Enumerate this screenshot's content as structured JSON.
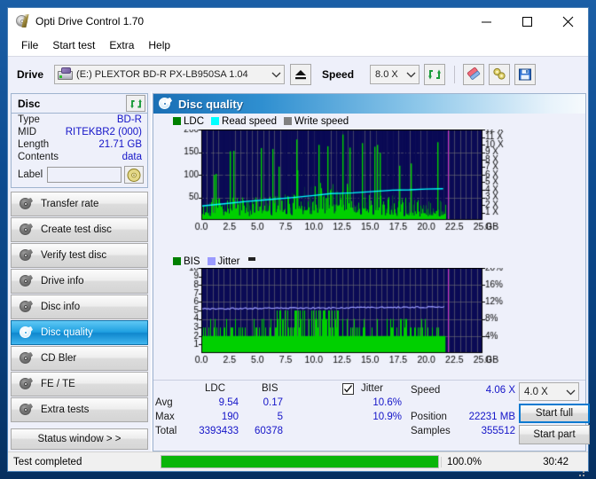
{
  "window": {
    "title": "Opti Drive Control 1.70",
    "icon": "disc-icon",
    "minimize": "minimize-icon",
    "maximize": "maximize-icon",
    "close": "close-icon"
  },
  "menu": {
    "items": [
      "File",
      "Start test",
      "Extra",
      "Help"
    ]
  },
  "toolbar": {
    "drive_label": "Drive",
    "drive_value": "(E:)  PLEXTOR BD-R  PX-LB950SA 1.04",
    "eject_icon": "eject-icon",
    "speed_label": "Speed",
    "speed_value": "8.0 X",
    "refresh_icon": "refresh-icon",
    "erase_icon": "eraser-icon",
    "tools_icon": "tools-icon",
    "save_icon": "save-floppy-icon"
  },
  "disc_panel": {
    "title": "Disc",
    "refresh_icon": "refresh-icon",
    "rows": [
      {
        "key": "Type",
        "value": "BD-R"
      },
      {
        "key": "MID",
        "value": "RITEKBR2 (000)"
      },
      {
        "key": "Length",
        "value": "21.71 GB"
      },
      {
        "key": "Contents",
        "value": "data"
      }
    ],
    "label_key": "Label",
    "label_value": "",
    "label_placeholder": "",
    "label_button_icon": "cd-icon"
  },
  "nav": {
    "items": [
      {
        "label": "Transfer rate",
        "active": false
      },
      {
        "label": "Create test disc",
        "active": false
      },
      {
        "label": "Verify test disc",
        "active": false
      },
      {
        "label": "Drive info",
        "active": false
      },
      {
        "label": "Disc info",
        "active": false
      },
      {
        "label": "Disc quality",
        "active": true
      },
      {
        "label": "CD Bler",
        "active": false
      },
      {
        "label": "FE / TE",
        "active": false
      },
      {
        "label": "Extra tests",
        "active": false
      }
    ],
    "status_window": "Status window > >"
  },
  "content": {
    "title": "Disc quality",
    "title_icon": "disc-quality-icon"
  },
  "chart_data": [
    {
      "type": "area",
      "title": "LDC / Read speed",
      "legend": [
        {
          "label": "LDC",
          "color": "#008000"
        },
        {
          "label": "Read speed",
          "color": "#00ffff"
        },
        {
          "label": "Write speed",
          "color": "#808080"
        }
      ],
      "legend_position": "top-left",
      "grid": true,
      "xlabel": "GB",
      "xlim": [
        0,
        25
      ],
      "xticks": [
        "0.0",
        "2.5",
        "5.0",
        "7.5",
        "10.0",
        "12.5",
        "15.0",
        "17.5",
        "20.0",
        "22.5",
        "25.0"
      ],
      "ylabel_left": "LDC",
      "ylim": [
        0,
        200
      ],
      "yticks_left": [
        "200",
        "150",
        "100",
        "50"
      ],
      "ylabel_right": "Speed",
      "ylim_right": [
        0,
        12
      ],
      "yticks_right": [
        "12 X",
        "11 X",
        "10 X",
        "9 X",
        "8 X",
        "7 X",
        "6 X",
        "5 X",
        "4 X",
        "3 X",
        "2 X",
        "1 X"
      ],
      "data_end_gb": 21.71,
      "cursor_gb": 21.9,
      "series": [
        {
          "name": "LDC",
          "color": "#00d000",
          "type": "filled-spikes",
          "baseline": [
            28,
            30,
            31,
            30,
            32,
            31,
            33,
            32,
            34,
            33,
            35,
            34,
            36,
            35,
            37,
            36,
            38,
            40,
            42,
            44,
            46,
            48,
            50,
            52,
            54,
            56,
            58,
            56,
            54,
            52,
            50,
            48,
            46,
            44,
            42,
            40,
            38,
            37,
            36,
            35,
            34,
            33,
            32,
            31,
            30,
            30,
            30,
            30,
            30,
            30
          ],
          "avg": 9.54,
          "max": 190,
          "total": 3393433,
          "spikes_gb": [
            1.1,
            1.25,
            2.5,
            2.85,
            5.3,
            6.3,
            6.9,
            8.4,
            8.55,
            10.4,
            11.2,
            12.5,
            12.9,
            13.2,
            14.3,
            15.4,
            15.6,
            15.85,
            17.6,
            18.6,
            21.0
          ],
          "spikes_val": [
            100,
            102,
            152,
            153,
            159,
            157,
            118,
            178,
            110,
            166,
            163,
            189,
            80,
            160,
            170,
            162,
            166,
            148,
            120,
            125,
            172
          ]
        },
        {
          "name": "Read speed",
          "color": "#00ffff",
          "type": "line",
          "points_gb": [
            0.0,
            2.0,
            4.0,
            6.0,
            8.0,
            10.0,
            11.5,
            12.5,
            13.5,
            15.0,
            17.0,
            18.5,
            20.0,
            21.5
          ],
          "points_x_speed": [
            1.85,
            2.15,
            2.45,
            2.7,
            2.95,
            3.25,
            3.5,
            3.55,
            3.6,
            3.75,
            3.95,
            4.0,
            4.1,
            4.15
          ]
        }
      ]
    },
    {
      "type": "area",
      "title": "BIS / Jitter",
      "legend": [
        {
          "label": "BIS",
          "color": "#008000"
        },
        {
          "label": "Jitter",
          "color": "#9a9aff"
        }
      ],
      "legend_position": "top-left",
      "grid": true,
      "xlabel": "GB",
      "xlim": [
        0,
        25
      ],
      "xticks": [
        "0.0",
        "2.5",
        "5.0",
        "7.5",
        "10.0",
        "12.5",
        "15.0",
        "17.5",
        "20.0",
        "22.5",
        "25.0"
      ],
      "ylabel_left": "BIS",
      "ylim": [
        0,
        10
      ],
      "yticks_left": [
        "10",
        "9",
        "8",
        "7",
        "6",
        "5",
        "4",
        "3",
        "2",
        "1"
      ],
      "ylabel_right": "Jitter",
      "ylim_right": [
        0,
        20
      ],
      "yticks_right": [
        "20%",
        "16%",
        "12%",
        "8%",
        "4%"
      ],
      "data_end_gb": 21.71,
      "cursor_gb": 21.9,
      "series": [
        {
          "name": "BIS",
          "color": "#00d000",
          "type": "filled-spikes",
          "baseline_value": 2,
          "avg": 0.17,
          "max": 5,
          "total": 60378
        },
        {
          "name": "Jitter",
          "color": "#9a9aff",
          "type": "line",
          "avg_pct": 10.6,
          "max_pct": 10.9,
          "level_start": 5.2,
          "level_end": 5.4
        }
      ]
    }
  ],
  "stats": {
    "col_headers": [
      "LDC",
      "BIS"
    ],
    "row_headers": [
      "Avg",
      "Max",
      "Total"
    ],
    "ldc": {
      "avg": "9.54",
      "max": "190",
      "total": "3393433"
    },
    "bis": {
      "avg": "0.17",
      "max": "5",
      "total": "60378"
    },
    "jitter_label": "Jitter",
    "jitter_checked": true,
    "jitter_avg": "10.6%",
    "jitter_max": "10.9%",
    "speed_label": "Speed",
    "speed_value": "4.06 X",
    "position_label": "Position",
    "position_value": "22231 MB",
    "samples_label": "Samples",
    "samples_value": "355512",
    "speed_select": "4.0 X",
    "start_full": "Start full",
    "start_part": "Start part"
  },
  "statusbar": {
    "message": "Test completed",
    "percent": "100.0%",
    "progress": 100,
    "time": "30:42"
  }
}
